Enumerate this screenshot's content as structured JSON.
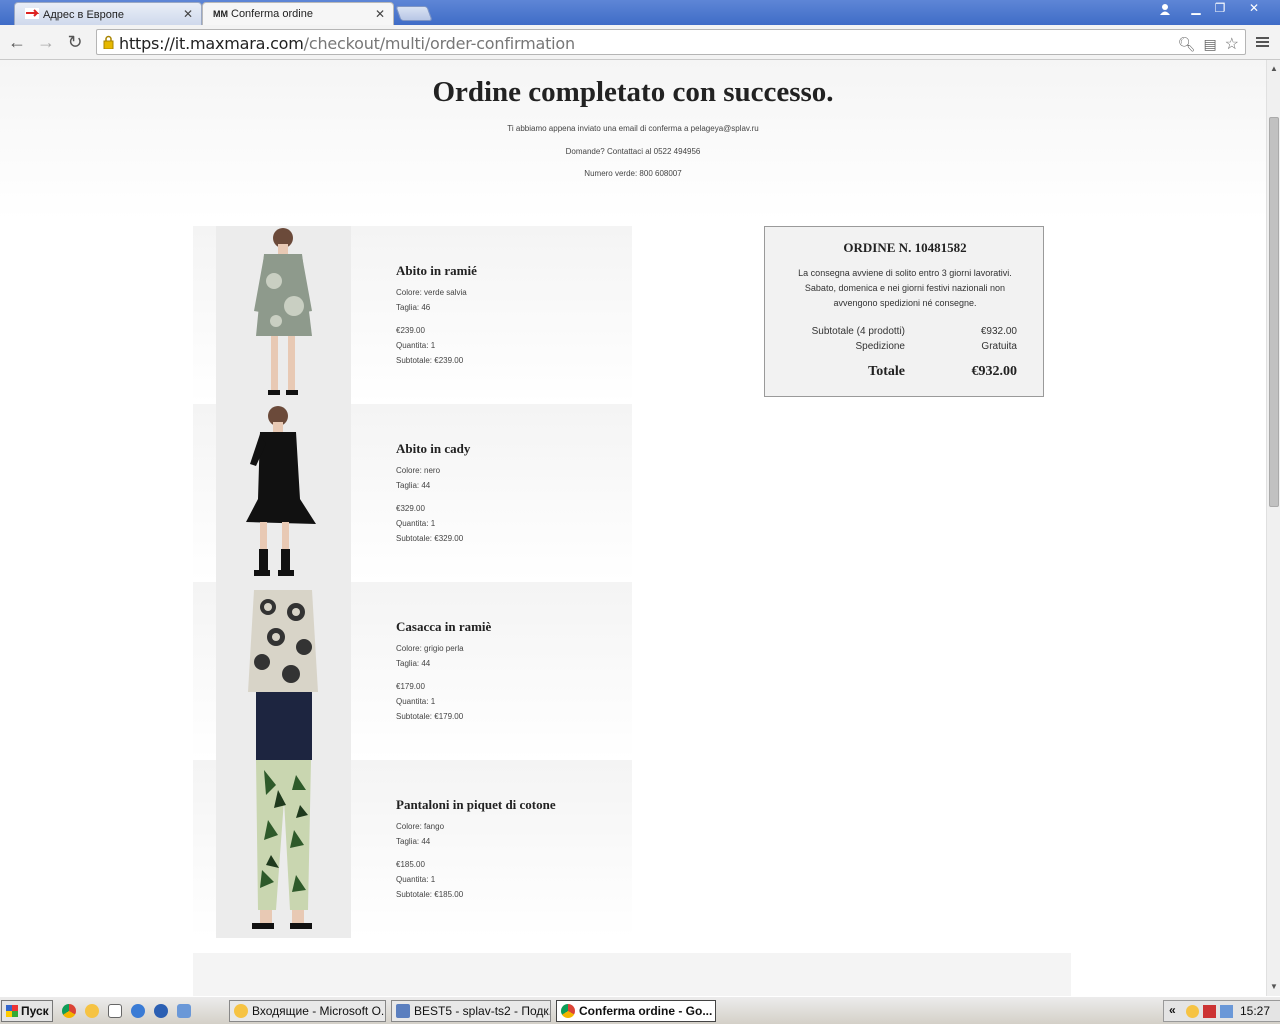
{
  "browser": {
    "tabs": [
      {
        "label": "Адрес в Европе",
        "active": false,
        "icon": "red-plane-favicon"
      },
      {
        "label": "Conferma ordine",
        "active": true,
        "icon": "mm-favicon",
        "prefix": "MM"
      }
    ],
    "url_scheme_host": "https://it.maxmara.com",
    "url_path": "/checkout/multi/order-confirmation"
  },
  "page": {
    "title": "Ordine completato con successo.",
    "email_note": "Ti abbiamo appena inviato una email di conferma a pelageya@splav.ru",
    "contact": "Domande? Contattaci al   0522 494956",
    "toll_free": "Numero verde: 800 608007"
  },
  "items": [
    {
      "name": "Abito in ramié",
      "color": "Colore: verde salvia",
      "size": "Taglia:   46",
      "price": "€239.00",
      "qty": "Quantita: 1",
      "subtotal": "Subtotale: €239.00",
      "swatch": "#8e9a8c"
    },
    {
      "name": "Abito in cady",
      "color": "Colore: nero",
      "size": "Taglia:   44",
      "price": "€329.00",
      "qty": "Quantita: 1",
      "subtotal": "Subtotale: €329.00",
      "swatch": "#111111"
    },
    {
      "name": "Casacca in ramiè",
      "color": "Colore: grigio perla",
      "size": "Taglia:   44",
      "price": "€179.00",
      "qty": "Quantita: 1",
      "subtotal": "Subtotale: €179.00",
      "swatch": "#9e9a90"
    },
    {
      "name": "Pantaloni in piquet di cotone",
      "color": "Colore: fango",
      "size": "Taglia:   44",
      "price": "€185.00",
      "qty": "Quantita: 1",
      "subtotal": "Subtotale: €185.00",
      "swatch": "#8fa66a"
    }
  ],
  "summary": {
    "order_number": "ORDINE N. 10481582",
    "delivery_note": "La consegna avviene di solito entro 3 giorni lavorativi. Sabato, domenica e nei giorni festivi nazionali non avvengono spedizioni né consegne.",
    "subtotal_label": "Subtotale (4 prodotti)",
    "subtotal_value": "€932.00",
    "shipping_label": "Spedizione",
    "shipping_value": "Gratuita",
    "total_label": "Totale",
    "total_value": "€932.00"
  },
  "taskbar": {
    "start_label": "Пуск",
    "windows": [
      {
        "label": "Входящие - Microsoft O...",
        "icon": "outlook-icon",
        "active": false
      },
      {
        "label": "BEST5 - splav-ts2 - Подк...",
        "icon": "remote-desktop-icon",
        "active": false
      },
      {
        "label": "Conferma ordine - Go...",
        "icon": "chrome-icon",
        "active": true
      }
    ],
    "clock": "15:27"
  }
}
